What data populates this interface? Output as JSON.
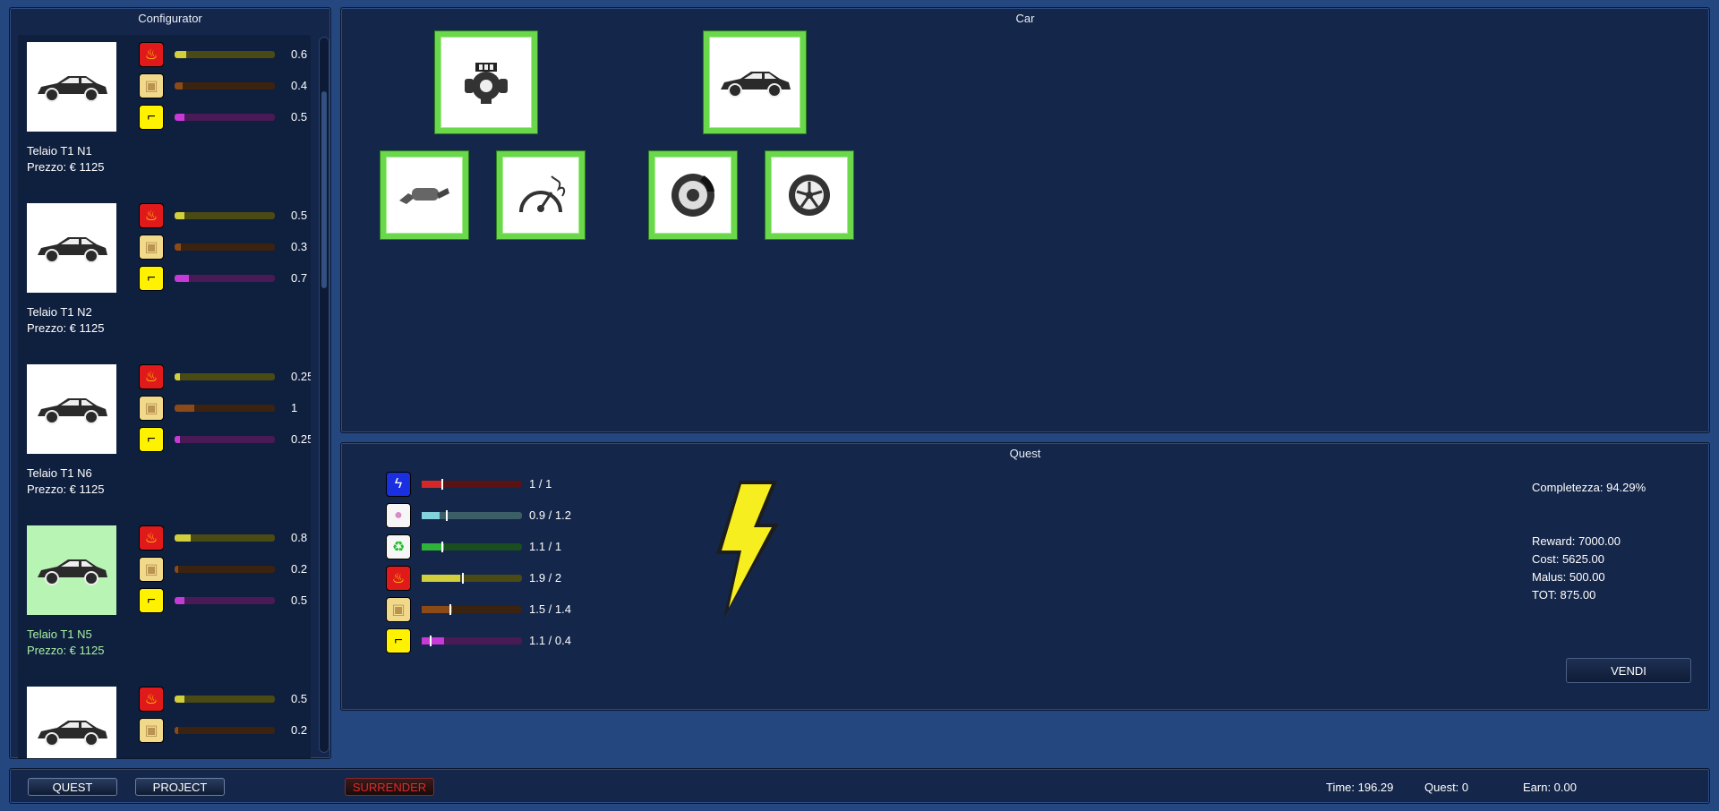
{
  "configurator": {
    "title": "Configurator",
    "items": [
      {
        "name": "Telaio T1 N1",
        "price": "Prezzo: € 1125",
        "selected": false,
        "stats": [
          {
            "value": "0.6",
            "level": 0.12
          },
          {
            "value": "0.4",
            "level": 0.08
          },
          {
            "value": "0.5",
            "level": 0.1
          }
        ]
      },
      {
        "name": "Telaio T1 N2",
        "price": "Prezzo: € 1125",
        "selected": false,
        "stats": [
          {
            "value": "0.5",
            "level": 0.1
          },
          {
            "value": "0.3",
            "level": 0.06
          },
          {
            "value": "0.7",
            "level": 0.14
          }
        ]
      },
      {
        "name": "Telaio T1 N6",
        "price": "Prezzo: € 1125",
        "selected": false,
        "stats": [
          {
            "value": "0.25",
            "level": 0.05
          },
          {
            "value": "1",
            "level": 0.2
          },
          {
            "value": "0.25",
            "level": 0.05
          }
        ]
      },
      {
        "name": "Telaio T1 N5",
        "price": "Prezzo: € 1125",
        "selected": true,
        "stats": [
          {
            "value": "0.8",
            "level": 0.16
          },
          {
            "value": "0.2",
            "level": 0.04
          },
          {
            "value": "0.5",
            "level": 0.1
          }
        ]
      },
      {
        "name": "",
        "price": "",
        "selected": false,
        "stats": [
          {
            "value": "0.5",
            "level": 0.1
          },
          {
            "value": "0.2",
            "level": 0.04
          }
        ]
      }
    ]
  },
  "car": {
    "title": "Car",
    "slots": [
      "engine-icon",
      "car-body-icon",
      "exhaust-icon",
      "turbo-gauge-icon",
      "brake-disc-icon",
      "wheel-icon"
    ]
  },
  "quest": {
    "title": "Quest",
    "rows": [
      {
        "icon": "lightning-icon",
        "value": "1 / 1",
        "level": 0.2,
        "target": 0.2
      },
      {
        "icon": "piggy-bank-icon",
        "value": "0.9 / 1.2",
        "level": 0.18,
        "target": 0.24
      },
      {
        "icon": "recycle-icon",
        "value": "1.1 / 1",
        "level": 0.22,
        "target": 0.2
      },
      {
        "icon": "fire-icon",
        "value": "1.9 / 2",
        "level": 0.38,
        "target": 0.4
      },
      {
        "icon": "box-icon",
        "value": "1.5 / 1.4",
        "level": 0.3,
        "target": 0.28
      },
      {
        "icon": "sunglasses-icon",
        "value": "1.1 / 0.4",
        "level": 0.22,
        "target": 0.08
      }
    ],
    "completeness": "Completezza: 94.29%",
    "reward": "Reward: 7000.00",
    "cost": "Cost: 5625.00",
    "malus": "Malus: 500.00",
    "tot": "TOT: 875.00",
    "sell_label": "VENDI"
  },
  "bottom": {
    "quest_label": "QUEST",
    "project_label": "PROJECT",
    "surrender_label": "SURRENDER",
    "time": "Time: 196.29",
    "quest_count": "Quest: 0",
    "earn": "Earn: 0.00"
  }
}
